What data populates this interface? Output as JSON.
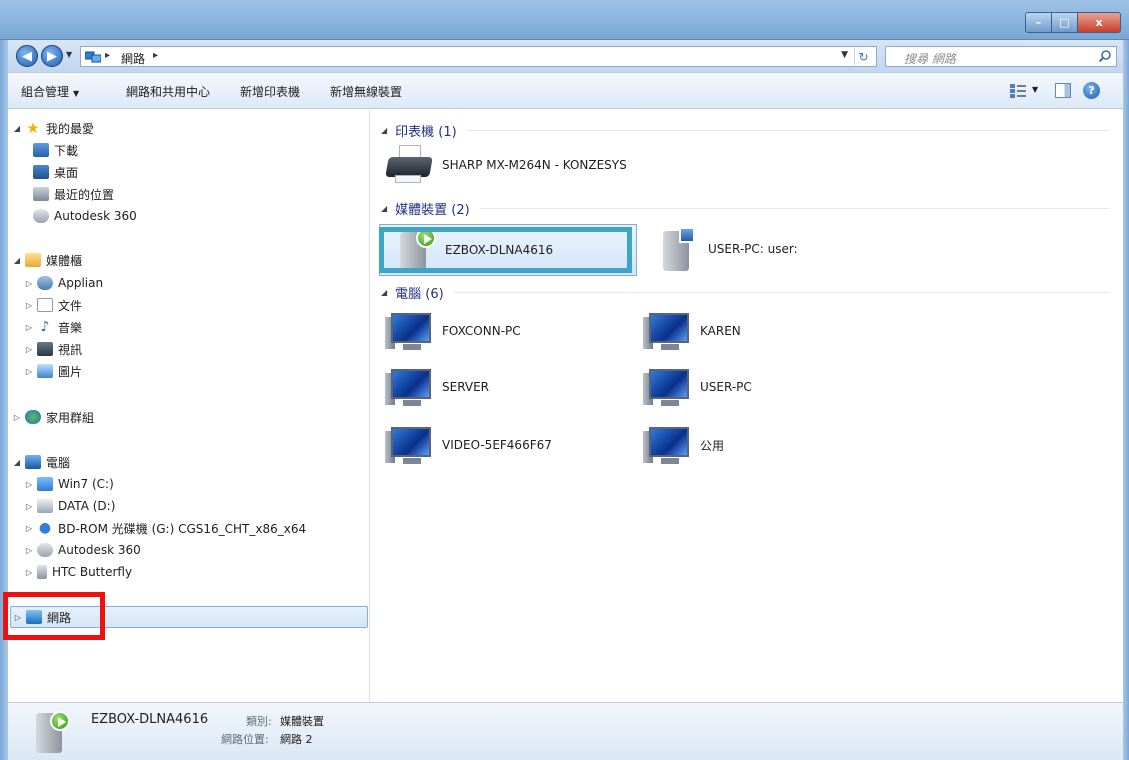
{
  "window": {
    "caption_buttons": [
      "–",
      "□",
      "x"
    ]
  },
  "address": {
    "crumb": "網路",
    "search_placeholder": "搜尋 網路"
  },
  "commands": {
    "organize": "組合管理",
    "network_center": "網路和共用中心",
    "add_printer": "新增印表機",
    "add_wireless": "新增無線裝置"
  },
  "nav": {
    "favorites": "我的最愛",
    "downloads": "下載",
    "desktop": "桌面",
    "recent": "最近的位置",
    "autodesk_fav": "Autodesk 360",
    "libraries": "媒體櫃",
    "applian": "Applian",
    "documents": "文件",
    "music": "音樂",
    "videos": "視訊",
    "pictures": "圖片",
    "homegroup": "家用群組",
    "computer": "電腦",
    "win7": "Win7 (C:)",
    "data": "DATA (D:)",
    "bdrom": "BD-ROM 光碟機 (G:) CGS16_CHT_x86_x64",
    "autodesk_pc": "Autodesk 360",
    "htc": "HTC Butterfly",
    "network": "網路"
  },
  "groups": {
    "printers": "印表機 (1)",
    "media": "媒體裝置 (2)",
    "computers": "電腦 (6)"
  },
  "items": {
    "printer": "SHARP MX-M264N - KONZESYS",
    "media1": "EZBOX-DLNA4616",
    "media2": "USER-PC: user:",
    "pc1": "FOXCONN-PC",
    "pc2": "KAREN",
    "pc3": "SERVER",
    "pc4": "USER-PC",
    "pc5": "VIDEO-5EF466F67",
    "pc6": "公用"
  },
  "details": {
    "name": "EZBOX-DLNA4616",
    "category_label": "類別:",
    "category_value": "媒體裝置",
    "location_label": "網路位置:",
    "location_value": "網路 2"
  },
  "colors": {
    "highlight_red": "#ee1111",
    "highlight_cyan": "#3ea6c2",
    "group_header": "#1e3287"
  }
}
